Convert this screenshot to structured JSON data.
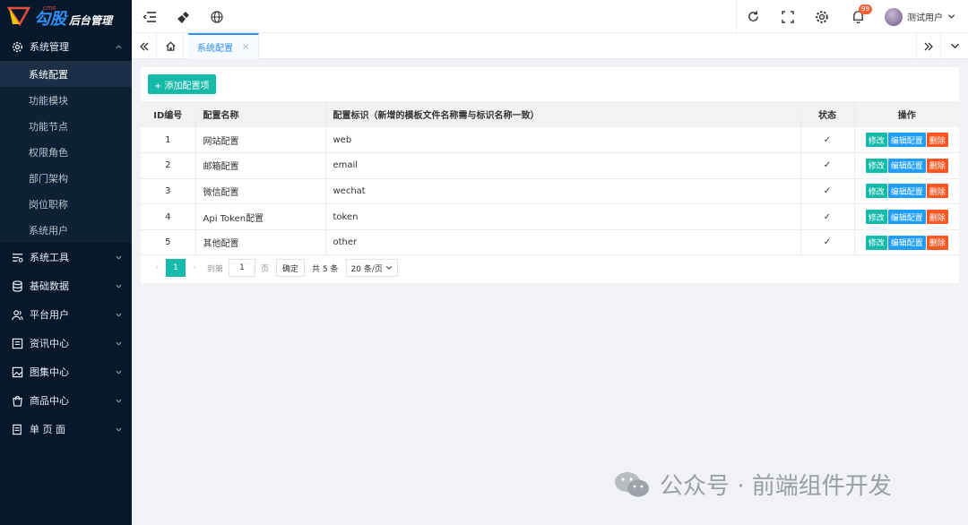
{
  "logo": {
    "cms": "cms",
    "main": "勾股",
    "sub": "后台管理"
  },
  "sidebar": {
    "groups": [
      {
        "label": "系统管理",
        "icon": "gear-icon",
        "expanded": true,
        "items": [
          "系统配置",
          "功能模块",
          "功能节点",
          "权限角色",
          "部门架构",
          "岗位职称",
          "系统用户"
        ]
      },
      {
        "label": "系统工具",
        "icon": "tools-icon"
      },
      {
        "label": "基础数据",
        "icon": "database-icon"
      },
      {
        "label": "平台用户",
        "icon": "users-icon"
      },
      {
        "label": "资讯中心",
        "icon": "news-icon"
      },
      {
        "label": "图集中心",
        "icon": "gallery-icon"
      },
      {
        "label": "商品中心",
        "icon": "shop-icon"
      },
      {
        "label": "单 页 面",
        "icon": "page-icon"
      }
    ],
    "active_item": "系统配置"
  },
  "topbar": {
    "notification_count": "99",
    "user_name": "测试用户"
  },
  "tabs": {
    "current": "系统配置",
    "close": "×"
  },
  "toolbar": {
    "add_label": "+ 添加配置项"
  },
  "table": {
    "headers": [
      "ID编号",
      "配置名称",
      "配置标识（新增的模板文件名称需与标识名称一致）",
      "状态",
      "操作"
    ],
    "rows": [
      {
        "id": "1",
        "name": "网站配置",
        "key": "web",
        "status": "✓"
      },
      {
        "id": "2",
        "name": "邮箱配置",
        "key": "email",
        "status": "✓"
      },
      {
        "id": "3",
        "name": "微信配置",
        "key": "wechat",
        "status": "✓"
      },
      {
        "id": "4",
        "name": "Api Token配置",
        "key": "token",
        "status": "✓"
      },
      {
        "id": "5",
        "name": "其他配置",
        "key": "other",
        "status": "✓"
      }
    ],
    "actions": {
      "edit": "修改",
      "config": "编辑配置",
      "delete": "删除"
    }
  },
  "pager": {
    "prev": "‹",
    "current": "1",
    "next": "›",
    "goto": "到第",
    "page_input": "1",
    "page_unit": "页",
    "confirm": "确定",
    "total": "共 5 条",
    "per_page": "20 条/页"
  },
  "watermark": {
    "text": "公众号 · 前端组件开发"
  }
}
